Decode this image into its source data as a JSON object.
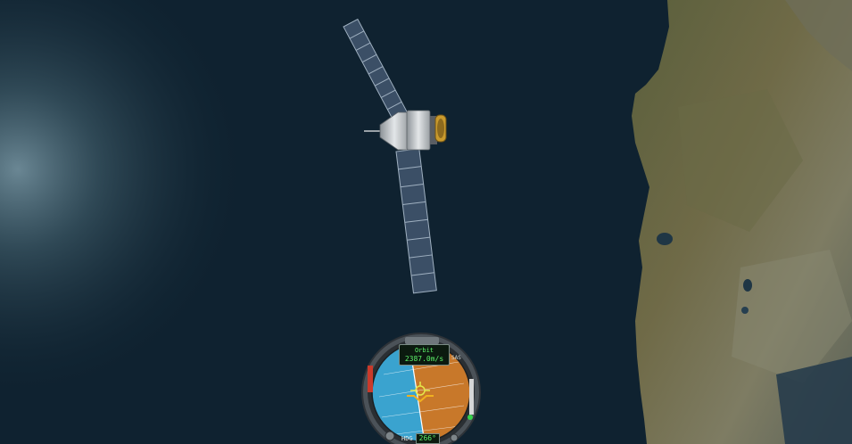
{
  "navball": {
    "speed_mode": "Orbit",
    "speed": "2387.0m/s",
    "heading_label": "HDG",
    "heading_value": "266°",
    "sas_label": "SAS"
  },
  "colors": {
    "space": "#0f2230",
    "sky_hemisphere": "#3aa3cf",
    "ground_hemisphere": "#c8782a",
    "readout_text": "#5df26a"
  }
}
